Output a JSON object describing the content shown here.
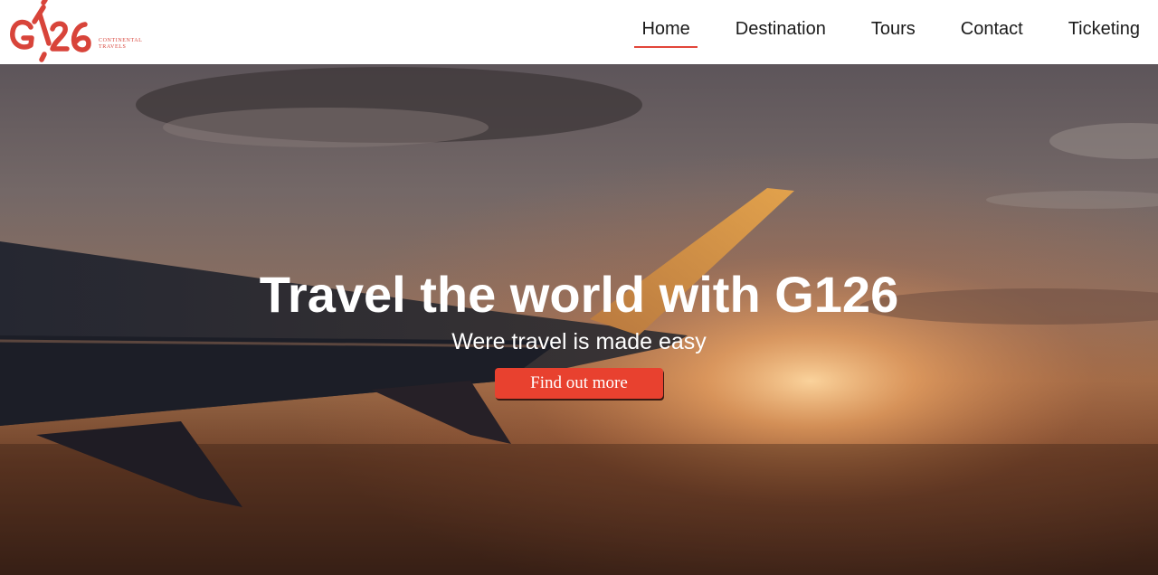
{
  "brand": {
    "logo_text": "G126",
    "tagline_line1": "CONTINENTAL",
    "tagline_line2": "TRAVELS",
    "accent_color": "#e2463a"
  },
  "nav": {
    "items": [
      {
        "label": "Home",
        "active": true
      },
      {
        "label": "Destination",
        "active": false
      },
      {
        "label": "Tours",
        "active": false
      },
      {
        "label": "Contact",
        "active": false
      },
      {
        "label": "Ticketing",
        "active": false
      }
    ]
  },
  "hero": {
    "title": "Travel the world with G126",
    "subtitle": "Were travel is made easy",
    "button_label": "Find out more",
    "button_color": "#e8412f",
    "background": "airplane-wing-sunset-image"
  }
}
